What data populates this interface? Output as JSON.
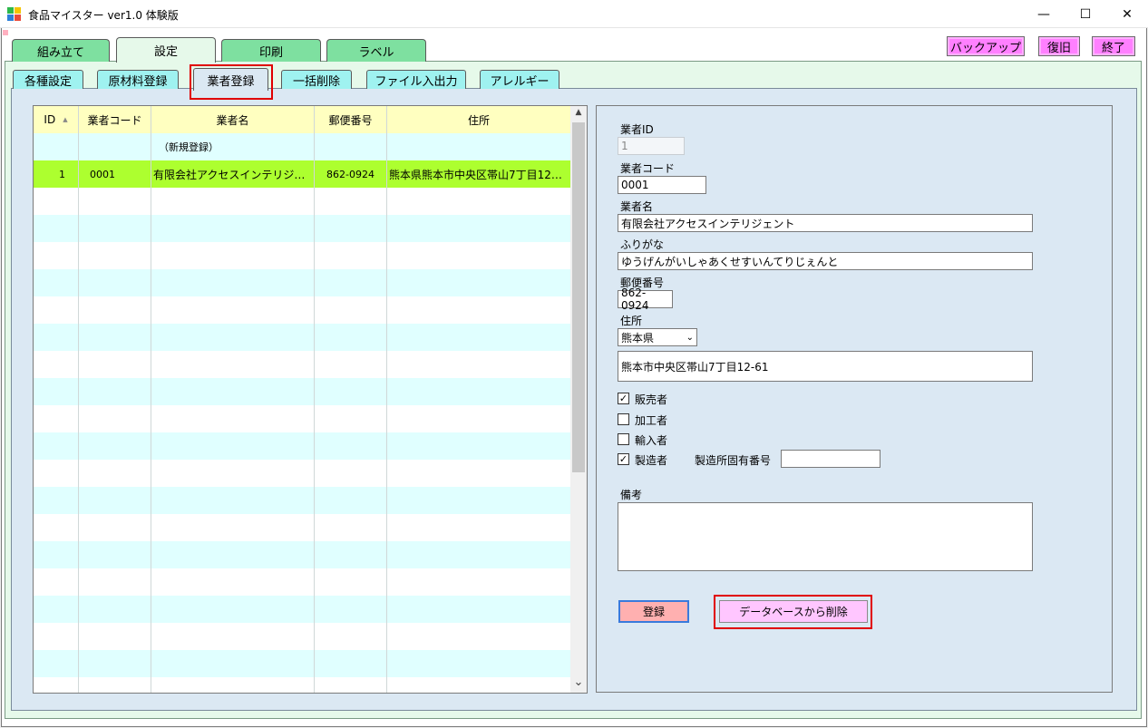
{
  "window": {
    "title": "食品マイスター ver1.0 体験版",
    "minimize": "—",
    "maximize": "☐",
    "close": "✕"
  },
  "main_tabs": [
    {
      "label": "組み立て"
    },
    {
      "label": "設定"
    },
    {
      "label": "印刷"
    },
    {
      "label": "ラベル"
    }
  ],
  "top_buttons": {
    "backup": "バックアップ",
    "restore": "復旧",
    "exit": "終了"
  },
  "sub_tabs": [
    {
      "label": "各種設定"
    },
    {
      "label": "原材料登録"
    },
    {
      "label": "業者登録"
    },
    {
      "label": "一括削除"
    },
    {
      "label": "ファイル入出力"
    },
    {
      "label": "アレルギー"
    }
  ],
  "grid": {
    "headers": [
      "ID",
      "業者コード",
      "業者名",
      "郵便番号",
      "住所"
    ],
    "sort_indicator": "▲",
    "new_row": "（新規登録）",
    "rows": [
      [
        "1",
        "0001",
        "有限会社アクセスインテリジ…",
        "862-0924",
        "熊本県熊本市中央区帯山7丁目12…"
      ]
    ],
    "scroll_up": "▲",
    "scroll_down": "⌄"
  },
  "form": {
    "id_label": "業者ID",
    "id_value": "1",
    "code_label": "業者コード",
    "code_value": "0001",
    "name_label": "業者名",
    "name_value": "有限会社アクセスインテリジェント",
    "kana_label": "ふりがな",
    "kana_value": "ゆうげんがいしゃあくせすいんてりじぇんと",
    "zip_label": "郵便番号",
    "zip_value": "862-0924",
    "address_label": "住所",
    "prefecture": "熊本県",
    "address_value": "熊本市中央区帯山7丁目12-61",
    "roles": [
      {
        "label": "販売者",
        "checked": true
      },
      {
        "label": "加工者",
        "checked": false
      },
      {
        "label": "輸入者",
        "checked": false
      },
      {
        "label": "製造者",
        "checked": true
      }
    ],
    "factory_code_label": "製造所固有番号",
    "factory_code_value": "",
    "notes_label": "備考",
    "notes_value": "",
    "register_button": "登録",
    "delete_button": "データベースから削除",
    "checkmark": "✓"
  },
  "colors": {
    "main_tab": "#7ee0a0",
    "sub_tab": "#9ff2f0",
    "selected_row": "#adff2f",
    "row_alt": "#e0ffff",
    "header_row": "#ffffc0",
    "highlight": "#e00000"
  }
}
